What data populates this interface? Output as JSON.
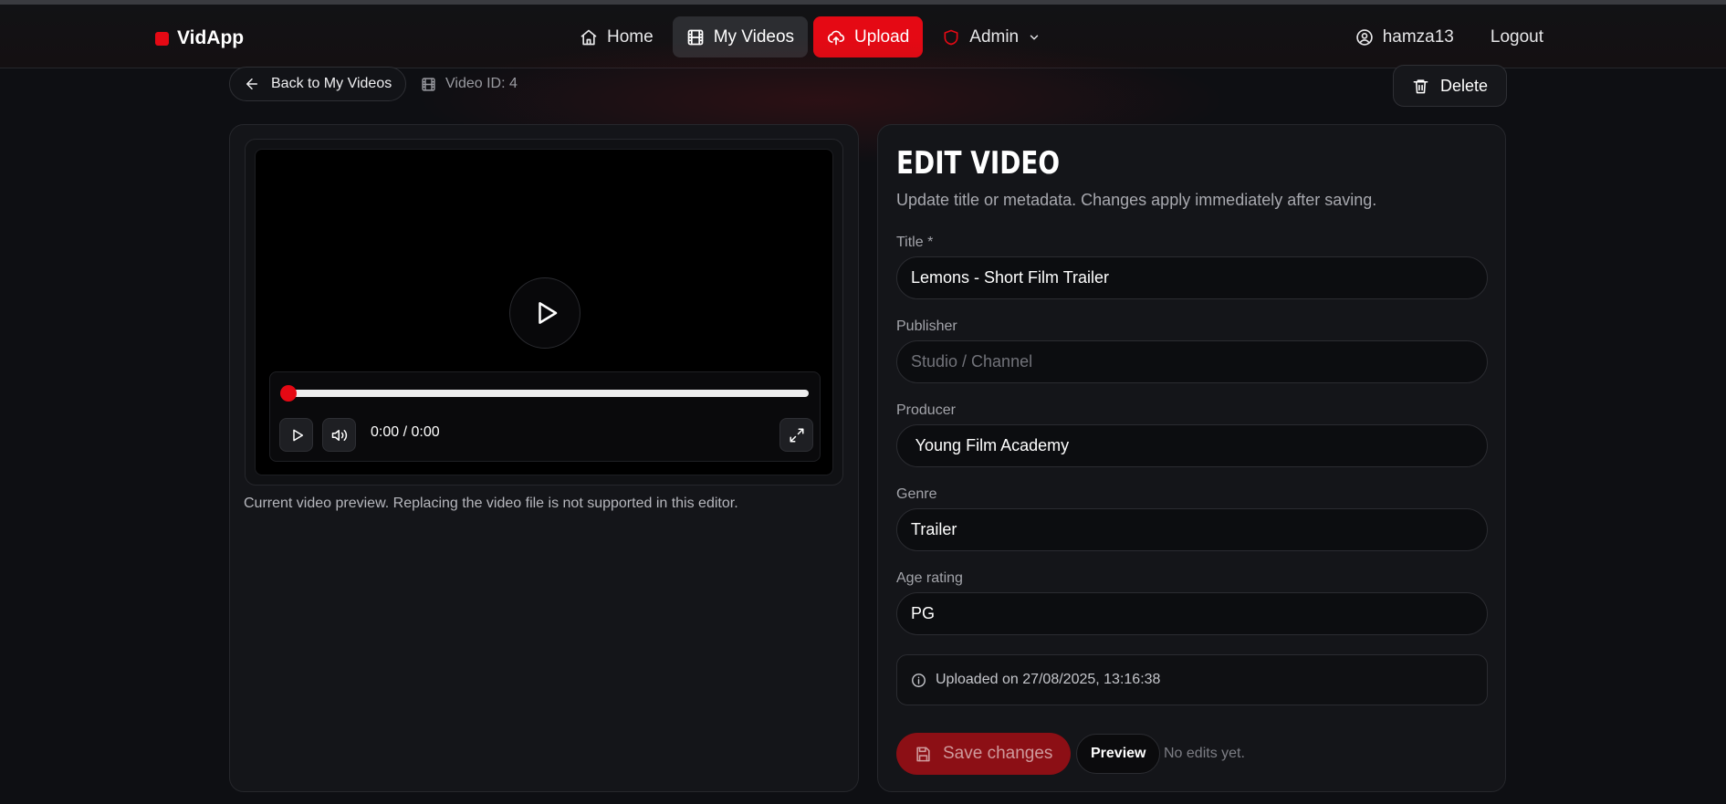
{
  "app": {
    "name": "VidApp",
    "brand_color": "#e50914"
  },
  "nav": {
    "items": [
      {
        "label": "Home",
        "icon": "home-icon"
      },
      {
        "label": "My Videos",
        "icon": "film-icon",
        "active": true
      },
      {
        "label": "Upload",
        "icon": "cloud-upload-icon"
      },
      {
        "label": "Admin",
        "icon": "shield-icon"
      }
    ],
    "user": "hamza13",
    "logout": "Logout"
  },
  "subbar": {
    "back_label": "Back to My Videos",
    "video_id": "Video ID: 4",
    "delete_label": "Delete"
  },
  "player": {
    "time": "0:00 / 0:00",
    "progress": 0,
    "note": "Current video preview. Replacing the video file is not supported in this editor."
  },
  "form": {
    "heading": "EDIT VIDEO",
    "subheading": "Update title or metadata. Changes apply immediately after saving.",
    "fields": [
      {
        "label": "Title *",
        "value": "Lemons - Short Film Trailer",
        "placeholder": ""
      },
      {
        "label": "Publisher",
        "value": "",
        "placeholder": "Studio / Channel"
      },
      {
        "label": "Producer",
        "value": " Young Film Academy",
        "placeholder": ""
      },
      {
        "label": "Genre",
        "value": "Trailer",
        "placeholder": ""
      },
      {
        "label": "Age rating",
        "value": "PG",
        "placeholder": ""
      }
    ],
    "uploaded": "Uploaded on 27/08/2025, 13:16:38",
    "save_label": "Save changes",
    "preview_label": "Preview",
    "status": "No edits yet."
  }
}
